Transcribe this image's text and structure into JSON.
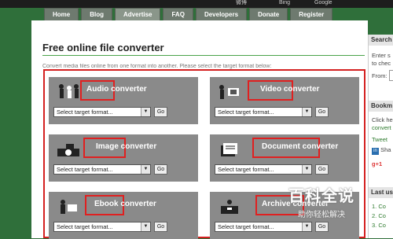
{
  "browser_strip": {
    "items": [
      "微博",
      "Bing",
      "Google"
    ]
  },
  "nav": {
    "tabs": [
      "Home",
      "Blog",
      "Advertise",
      "FAQ",
      "Developers",
      "Donate",
      "Register"
    ]
  },
  "main": {
    "title": "Free online file converter",
    "intro": "Convert media files online from one format into another. Please select the target format below:",
    "select_placeholder": "Select target format...",
    "go_label": "Go",
    "converters": [
      {
        "label": "Audio converter"
      },
      {
        "label": "Video converter"
      },
      {
        "label": "Image converter"
      },
      {
        "label": "Document converter"
      },
      {
        "label": "Ebook converter"
      },
      {
        "label": "Archive converter"
      }
    ]
  },
  "sidebar": {
    "search_header": "Search",
    "search_text1": "Enter s",
    "search_text2": "to chec",
    "from_label": "From:",
    "bookmark_header": "Bookm",
    "click_text": "Click he",
    "convert_text": "convert",
    "tweet_text": "Tweet",
    "share_text": "Sha",
    "gplus_text": "g+1",
    "last_header": "Last us",
    "list": [
      "1. Co",
      "2. Co",
      "3. Co"
    ]
  },
  "watermark": {
    "big": "百科全说",
    "small": "助你轻松解决"
  },
  "colors": {
    "accent_green": "#4aa34a",
    "highlight_red": "#e02020",
    "panel_gray": "#8a8a8a"
  }
}
